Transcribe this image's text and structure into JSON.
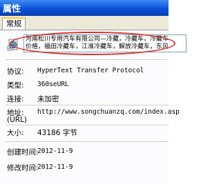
{
  "window": {
    "title": "属性"
  },
  "tabs": [
    {
      "label": "常规"
    }
  ],
  "file": {
    "name_line1": "河南松川专用汽车有限公司—冷藏，冷藏车，冷藏车",
    "name_line2": "价格，福田冷藏车，江淮冷藏车，解放冷藏车，东风"
  },
  "properties": {
    "protocol_label": "协议:",
    "protocol_value": "HyperText Transfer Protocol",
    "type_label": "类型:",
    "type_value": "360seURL",
    "connection_label": "连接:",
    "connection_value": "未加密",
    "address_label": "地址:",
    "address_label2": "(URL)",
    "address_value": "http://www.songchuanzq.com/index.asp",
    "size_label": "大小:",
    "size_value": "43186 字节",
    "created_label": "创建时间:",
    "created_value": "2012-11-9",
    "modified_label": "修改时间:",
    "modified_value": "2012-11-9"
  }
}
